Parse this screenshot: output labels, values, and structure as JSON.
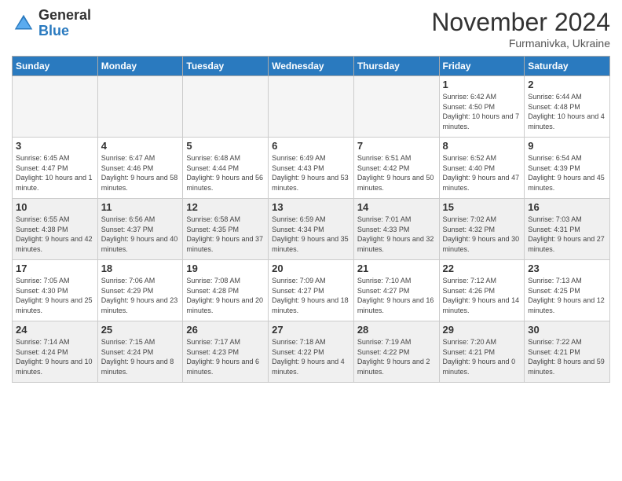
{
  "header": {
    "logo_general": "General",
    "logo_blue": "Blue",
    "month_title": "November 2024",
    "location": "Furmanivka, Ukraine"
  },
  "days_of_week": [
    "Sunday",
    "Monday",
    "Tuesday",
    "Wednesday",
    "Thursday",
    "Friday",
    "Saturday"
  ],
  "weeks": [
    [
      {
        "day": "",
        "info": "",
        "empty": true
      },
      {
        "day": "",
        "info": "",
        "empty": true
      },
      {
        "day": "",
        "info": "",
        "empty": true
      },
      {
        "day": "",
        "info": "",
        "empty": true
      },
      {
        "day": "",
        "info": "",
        "empty": true
      },
      {
        "day": "1",
        "info": "Sunrise: 6:42 AM\nSunset: 4:50 PM\nDaylight: 10 hours and 7 minutes."
      },
      {
        "day": "2",
        "info": "Sunrise: 6:44 AM\nSunset: 4:48 PM\nDaylight: 10 hours and 4 minutes."
      }
    ],
    [
      {
        "day": "3",
        "info": "Sunrise: 6:45 AM\nSunset: 4:47 PM\nDaylight: 10 hours and 1 minute."
      },
      {
        "day": "4",
        "info": "Sunrise: 6:47 AM\nSunset: 4:46 PM\nDaylight: 9 hours and 58 minutes."
      },
      {
        "day": "5",
        "info": "Sunrise: 6:48 AM\nSunset: 4:44 PM\nDaylight: 9 hours and 56 minutes."
      },
      {
        "day": "6",
        "info": "Sunrise: 6:49 AM\nSunset: 4:43 PM\nDaylight: 9 hours and 53 minutes."
      },
      {
        "day": "7",
        "info": "Sunrise: 6:51 AM\nSunset: 4:42 PM\nDaylight: 9 hours and 50 minutes."
      },
      {
        "day": "8",
        "info": "Sunrise: 6:52 AM\nSunset: 4:40 PM\nDaylight: 9 hours and 47 minutes."
      },
      {
        "day": "9",
        "info": "Sunrise: 6:54 AM\nSunset: 4:39 PM\nDaylight: 9 hours and 45 minutes."
      }
    ],
    [
      {
        "day": "10",
        "info": "Sunrise: 6:55 AM\nSunset: 4:38 PM\nDaylight: 9 hours and 42 minutes."
      },
      {
        "day": "11",
        "info": "Sunrise: 6:56 AM\nSunset: 4:37 PM\nDaylight: 9 hours and 40 minutes."
      },
      {
        "day": "12",
        "info": "Sunrise: 6:58 AM\nSunset: 4:35 PM\nDaylight: 9 hours and 37 minutes."
      },
      {
        "day": "13",
        "info": "Sunrise: 6:59 AM\nSunset: 4:34 PM\nDaylight: 9 hours and 35 minutes."
      },
      {
        "day": "14",
        "info": "Sunrise: 7:01 AM\nSunset: 4:33 PM\nDaylight: 9 hours and 32 minutes."
      },
      {
        "day": "15",
        "info": "Sunrise: 7:02 AM\nSunset: 4:32 PM\nDaylight: 9 hours and 30 minutes."
      },
      {
        "day": "16",
        "info": "Sunrise: 7:03 AM\nSunset: 4:31 PM\nDaylight: 9 hours and 27 minutes."
      }
    ],
    [
      {
        "day": "17",
        "info": "Sunrise: 7:05 AM\nSunset: 4:30 PM\nDaylight: 9 hours and 25 minutes."
      },
      {
        "day": "18",
        "info": "Sunrise: 7:06 AM\nSunset: 4:29 PM\nDaylight: 9 hours and 23 minutes."
      },
      {
        "day": "19",
        "info": "Sunrise: 7:08 AM\nSunset: 4:28 PM\nDaylight: 9 hours and 20 minutes."
      },
      {
        "day": "20",
        "info": "Sunrise: 7:09 AM\nSunset: 4:27 PM\nDaylight: 9 hours and 18 minutes."
      },
      {
        "day": "21",
        "info": "Sunrise: 7:10 AM\nSunset: 4:27 PM\nDaylight: 9 hours and 16 minutes."
      },
      {
        "day": "22",
        "info": "Sunrise: 7:12 AM\nSunset: 4:26 PM\nDaylight: 9 hours and 14 minutes."
      },
      {
        "day": "23",
        "info": "Sunrise: 7:13 AM\nSunset: 4:25 PM\nDaylight: 9 hours and 12 minutes."
      }
    ],
    [
      {
        "day": "24",
        "info": "Sunrise: 7:14 AM\nSunset: 4:24 PM\nDaylight: 9 hours and 10 minutes."
      },
      {
        "day": "25",
        "info": "Sunrise: 7:15 AM\nSunset: 4:24 PM\nDaylight: 9 hours and 8 minutes."
      },
      {
        "day": "26",
        "info": "Sunrise: 7:17 AM\nSunset: 4:23 PM\nDaylight: 9 hours and 6 minutes."
      },
      {
        "day": "27",
        "info": "Sunrise: 7:18 AM\nSunset: 4:22 PM\nDaylight: 9 hours and 4 minutes."
      },
      {
        "day": "28",
        "info": "Sunrise: 7:19 AM\nSunset: 4:22 PM\nDaylight: 9 hours and 2 minutes."
      },
      {
        "day": "29",
        "info": "Sunrise: 7:20 AM\nSunset: 4:21 PM\nDaylight: 9 hours and 0 minutes."
      },
      {
        "day": "30",
        "info": "Sunrise: 7:22 AM\nSunset: 4:21 PM\nDaylight: 8 hours and 59 minutes."
      }
    ]
  ]
}
